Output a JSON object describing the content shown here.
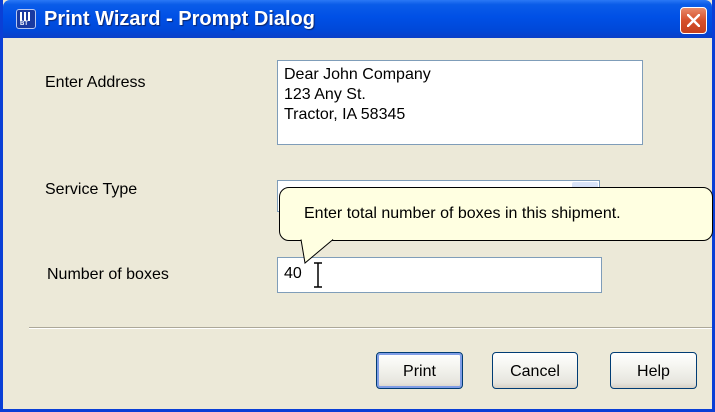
{
  "window": {
    "title": "Print Wizard - Prompt Dialog",
    "icon": "bartender-app-icon",
    "icon_text": "BT",
    "close_icon": "close-icon",
    "title_color": "#0050e6",
    "close_color": "#d6502a"
  },
  "form": {
    "address_label": "Enter Address",
    "address_lines": [
      "Dear John Company",
      "123 Any St.",
      "Tractor, IA 58345"
    ],
    "service_type_label": "Service Type",
    "service_type_value": "",
    "boxes_label": "Number of boxes",
    "boxes_value": "40"
  },
  "tooltip": {
    "text": "Enter total number of boxes in this shipment.",
    "background": "#ffffe1"
  },
  "buttons": {
    "print": "Print",
    "cancel": "Cancel",
    "help": "Help"
  }
}
